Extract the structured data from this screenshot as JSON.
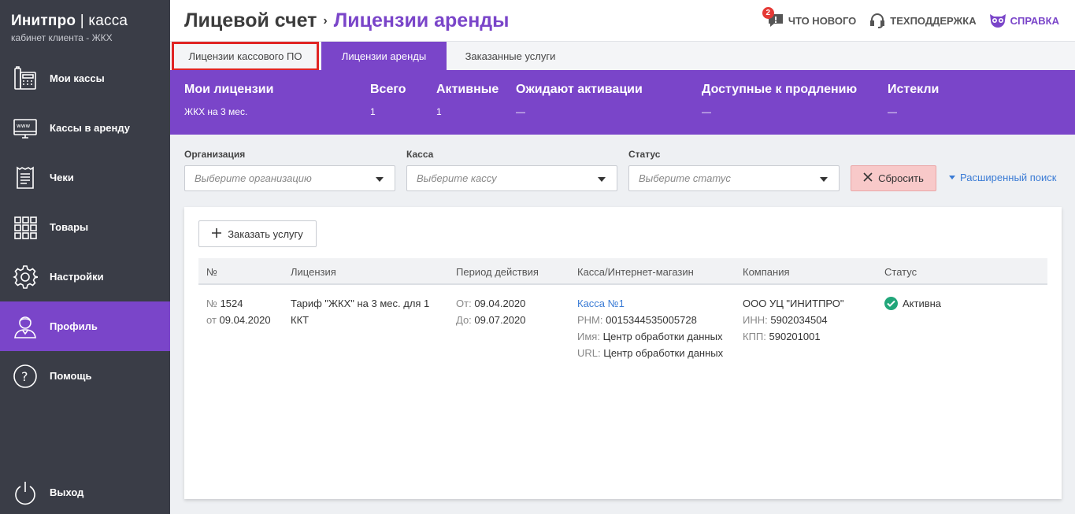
{
  "brand": {
    "name": "Инитпро",
    "separator": "|",
    "product": "касса",
    "subtitle": "кабинет клиента - ЖКХ"
  },
  "sidebar": {
    "items": [
      {
        "label": "Мои кассы",
        "icon": "cash-register-icon"
      },
      {
        "label": "Кассы в аренду",
        "icon": "www-monitor-icon"
      },
      {
        "label": "Чеки",
        "icon": "receipt-icon"
      },
      {
        "label": "Товары",
        "icon": "grid-icon"
      },
      {
        "label": "Настройки",
        "icon": "gear-icon"
      },
      {
        "label": "Профиль",
        "icon": "user-icon",
        "active": true
      },
      {
        "label": "Помощь",
        "icon": "question-icon"
      }
    ],
    "logout": {
      "label": "Выход",
      "icon": "power-icon"
    }
  },
  "header": {
    "title_main": "Лицевой счет",
    "title_arrow": "›",
    "title_sub": "Лицензии аренды",
    "links": {
      "whats_new": {
        "label": "ЧТО НОВОГО",
        "badge": "2"
      },
      "support": {
        "label": "ТЕХПОДДЕРЖКА"
      },
      "help": {
        "label": "СПРАВКА"
      }
    }
  },
  "tabs": [
    {
      "label": "Лицензии кассового ПО"
    },
    {
      "label": "Лицензии аренды",
      "active": true
    },
    {
      "label": "Заказанные услуги"
    }
  ],
  "summary": {
    "my_licenses": {
      "head": "Мои лицензии",
      "value": "ЖКХ на 3 мес."
    },
    "total": {
      "head": "Всего",
      "value": "1"
    },
    "active": {
      "head": "Активные",
      "value": "1"
    },
    "pending": {
      "head": "Ожидают активации",
      "value": "—"
    },
    "renewable": {
      "head": "Доступные к продлению",
      "value": "—"
    },
    "expired": {
      "head": "Истекли",
      "value": "—"
    }
  },
  "filters": {
    "organization": {
      "label": "Организация",
      "placeholder": "Выберите организацию"
    },
    "register": {
      "label": "Касса",
      "placeholder": "Выберите кассу"
    },
    "status": {
      "label": "Статус",
      "placeholder": "Выберите статус"
    },
    "reset_label": "Сбросить",
    "advanced_label": "Расширенный поиск"
  },
  "card": {
    "order_button": "Заказать услугу",
    "columns": {
      "number": "№",
      "license": "Лицензия",
      "period": "Период действия",
      "register": "Касса/Интернет-магазин",
      "company": "Компания",
      "status": "Статус"
    },
    "row": {
      "num_prefix": "№",
      "num": "1524",
      "date_prefix": "от",
      "date": "09.04.2020",
      "license_line1": "Тариф \"ЖКХ\" на 3 мес. для 1",
      "license_line2": "ККТ",
      "from_label": "От:",
      "from": "09.04.2020",
      "to_label": "До:",
      "to": "09.07.2020",
      "register_link": "Касса №1",
      "rnm_label": "РНМ:",
      "rnm": "0015344535005728",
      "name_label": "Имя:",
      "name": "Центр обработки данных",
      "url_label": "URL:",
      "url": "Центр обработки данных",
      "company_name": "ООО УЦ \"ИНИТПРО\"",
      "inn_label": "ИНН:",
      "inn": "5902034504",
      "kpp_label": "КПП:",
      "kpp": "590201001",
      "status": "Активна"
    }
  },
  "colors": {
    "accent": "#7a45c9",
    "sidebar": "#3a3d47",
    "link": "#3a7bd5",
    "success": "#21a67a",
    "reset_bg": "#f8c9c9",
    "highlight": "#e02424"
  }
}
